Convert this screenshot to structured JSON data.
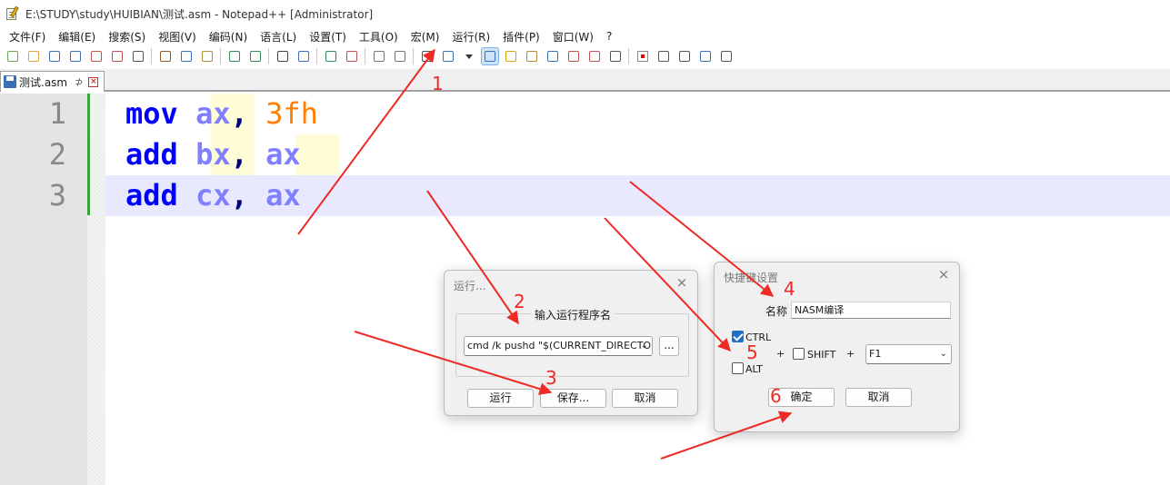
{
  "window": {
    "title": "E:\\STUDY\\study\\HUIBIAN\\测试.asm - Notepad++ [Administrator]"
  },
  "menu": [
    "文件(F)",
    "编辑(E)",
    "搜索(S)",
    "视图(V)",
    "编码(N)",
    "语言(L)",
    "设置(T)",
    "工具(O)",
    "宏(M)",
    "运行(R)",
    "插件(P)",
    "窗口(W)",
    "?"
  ],
  "toolbar": {
    "icons": [
      "new-file-icon",
      "open-file-icon",
      "save-icon",
      "save-all-icon",
      "close-icon",
      "close-all-icon",
      "print-icon",
      "cut-icon",
      "copy-icon",
      "paste-icon",
      "undo-icon",
      "redo-icon",
      "find-icon",
      "replace-icon",
      "zoom-in-icon",
      "zoom-out-icon",
      "sync-vertical-icon",
      "sync-horizontal-icon",
      "word-wrap-icon",
      "show-all-chars-icon",
      "dropdown-icon",
      "indent-guide-icon",
      "user-lang-icon",
      "doc-map-icon",
      "function-list-icon",
      "folder-workspace-icon",
      "doc-list-icon",
      "monitor-icon",
      "record-macro-icon",
      "stop-macro-icon",
      "play-macro-icon",
      "run-macro-multiple-icon",
      "save-macro-icon"
    ]
  },
  "tab": {
    "label": "测试.asm",
    "pin": "⊅",
    "close": "×"
  },
  "editor": {
    "line_numbers": [
      "1",
      "2",
      "3"
    ],
    "lines": [
      {
        "op": "mov",
        "reg": "ax",
        "sep": ", ",
        "arg": "3fh"
      },
      {
        "op": "add",
        "reg": "bx",
        "sep": ", ",
        "arg": "ax"
      },
      {
        "op": "add",
        "reg": "cx",
        "sep": ", ",
        "arg": "ax"
      }
    ]
  },
  "run_dialog": {
    "title": "运行...",
    "close": "×",
    "group_label": "输入运行程序名",
    "command": "cmd /k pushd \"$(CURRENT_DIRECTOR",
    "browse": "...",
    "buttons": {
      "run": "运行",
      "save": "保存...",
      "cancel": "取消"
    }
  },
  "shortcut_dialog": {
    "title": "快捷键设置",
    "close": "×",
    "name_label": "名称",
    "name_value": "NASM编译",
    "ctrl_label": "CTRL",
    "alt_label": "ALT",
    "shift_label": "SHIFT",
    "plus": "+",
    "key": "F1",
    "ctrl_checked": true,
    "alt_checked": false,
    "shift_checked": false,
    "buttons": {
      "ok": "确定",
      "cancel": "取消"
    }
  },
  "annotations": {
    "color": "#ee2a24",
    "labels": [
      "1",
      "2",
      "3",
      "4",
      "5",
      "6"
    ]
  }
}
